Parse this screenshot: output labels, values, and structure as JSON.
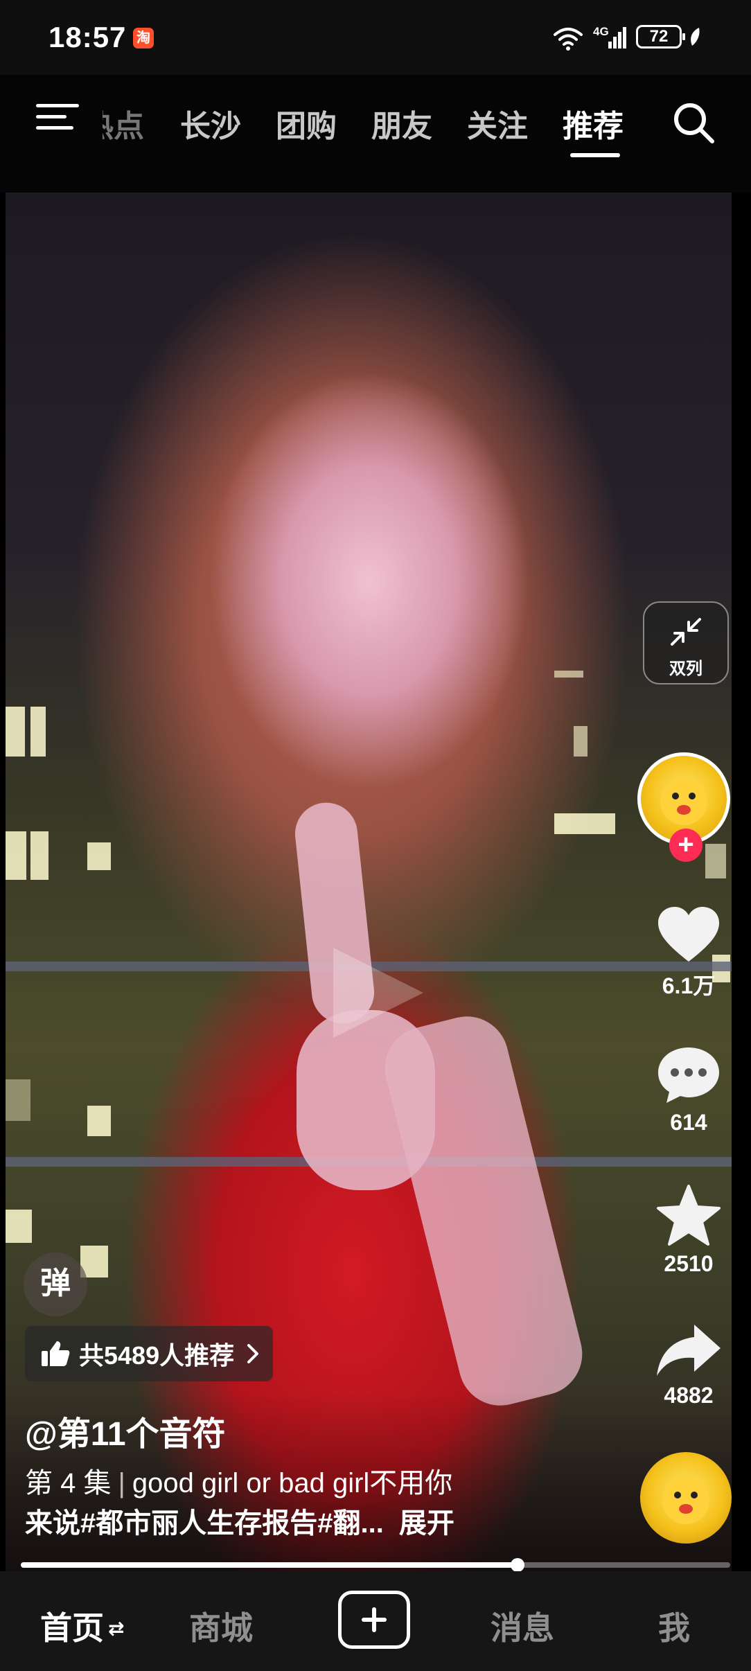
{
  "status_bar": {
    "time": "18:57",
    "app_badge": "淘",
    "network": "4G",
    "battery": "72"
  },
  "top_nav": {
    "tabs": [
      "热点",
      "长沙",
      "团购",
      "朋友",
      "关注",
      "推荐"
    ],
    "active_tab": "推荐"
  },
  "video": {
    "danmu_label": "弹",
    "recommend_text": "共5489人推荐",
    "author": "@第11个音符",
    "episode": "第 4 集",
    "description_line1": "good girl or bad girl不用你",
    "description_line2": "来说#都市丽人生存报告#翻...",
    "expand_label": "展开",
    "progress_fraction": 0.7
  },
  "side_actions": {
    "dual_column_label": "双列",
    "likes": "6.1万",
    "comments": "614",
    "favorites": "2510",
    "shares": "4882"
  },
  "bottom_nav": {
    "home": "首页",
    "mall": "商城",
    "messages": "消息",
    "me": "我"
  },
  "colors": {
    "accent": "#fe2c55",
    "nav_background": "#161616"
  }
}
